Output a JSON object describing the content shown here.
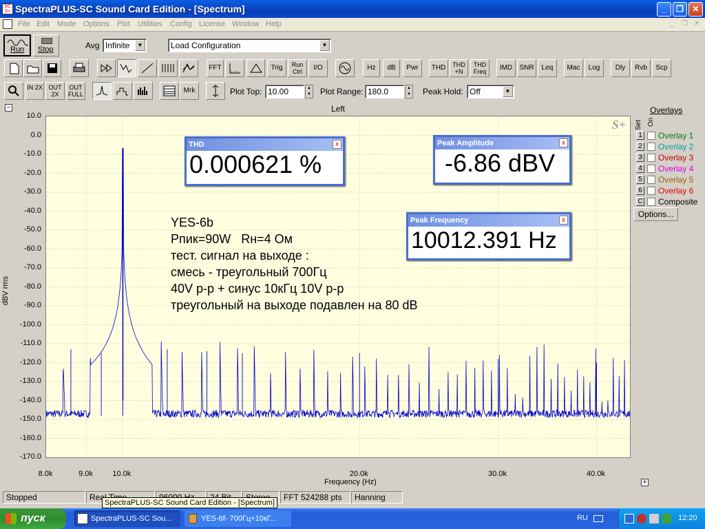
{
  "window": {
    "title": "SpectraPLUS-SC Sound Card Edition - [Spectrum]",
    "min": "_",
    "restore": "❐",
    "close": "✕"
  },
  "menu": [
    "File",
    "Edit",
    "Mode",
    "Options",
    "Plot",
    "Utilities",
    "Config",
    "License",
    "Window",
    "Help"
  ],
  "mdi": {
    "min": "_",
    "restore": "❐",
    "close": "✕"
  },
  "toolbar1": {
    "run": "Run",
    "stop": "Stop",
    "avg_label": "Avg",
    "avg_value": "Infinite",
    "config_value": "Load Configuration"
  },
  "toolbar2": [
    "FFT",
    "Trig",
    "Run Ctrl",
    "I/O",
    "Hz",
    "dB",
    "Pwr",
    "THD",
    "THD +N",
    "THD Freq",
    "IMD",
    "SNR",
    "Leq",
    "Mac",
    "Log",
    "Dly",
    "Rvb",
    "Scp"
  ],
  "toolbar3": {
    "zoom_in": "IN 2X",
    "zoom_out": "OUT 2X",
    "zoom_full": "OUT FULL",
    "mrk": "Mrk",
    "plot_top_label": "Plot Top:",
    "plot_top": "10.00",
    "plot_range_label": "Plot Range:",
    "plot_range": "180.0",
    "peak_hold_label": "Peak Hold:",
    "peak_hold": "Off"
  },
  "plot": {
    "collapse": "−",
    "channel": "Left",
    "ylabel": "dBV rms",
    "xlabel": "Frequency (Hz)",
    "logo": "S+",
    "expand": "+",
    "yticks": [
      "10.0",
      "0.0",
      "-10.0",
      "-20.0",
      "-30.0",
      "-40.0",
      "-50.0",
      "-60.0",
      "-70.0",
      "-80.0",
      "-90.0",
      "-100.0",
      "-110.0",
      "-120.0",
      "-130.0",
      "-140.0",
      "-150.0",
      "-160.0",
      "-170.0"
    ],
    "xticks": [
      "8.0k",
      "9.0k",
      "10.0k",
      "20.0k",
      "30.0k",
      "40.0k"
    ]
  },
  "chart_data": {
    "type": "line",
    "xlabel": "Frequency (Hz)",
    "ylabel": "dBV rms",
    "ylim": [
      -170,
      10
    ],
    "xlim": [
      8000,
      44100
    ],
    "xscale": "log",
    "grid": true,
    "series": [
      {
        "values_x": [
          10012.391
        ],
        "values_y": [
          -6.86
        ]
      }
    ],
    "color": "#0000c8",
    "noise_floor_dbv": -147,
    "peaks": [
      {
        "x": 8600.0,
        "y": -113
      },
      {
        "x": 9400.0,
        "y": -115
      },
      {
        "x": 10012.391,
        "y": -6.86
      },
      {
        "x": 11400.0,
        "y": -113
      },
      {
        "x": 12800.0,
        "y": -114
      },
      {
        "x": 14200.0,
        "y": -115
      },
      {
        "x": 20000.0,
        "y": -115
      },
      {
        "x": 30000.0,
        "y": -118
      },
      {
        "x": 40000.0,
        "y": -120
      }
    ]
  },
  "meters": {
    "thd": {
      "title": "THD",
      "value": "0.000621 %"
    },
    "peak_amp": {
      "title": "Peak Amplitude",
      "value": "-6.86 dBV"
    },
    "peak_freq": {
      "title": "Peak Frequency",
      "value": "10012.391 Hz"
    },
    "close": "x"
  },
  "annotation": [
    "YES-6b",
    "Рпик=90W   Rн=4 Ом",
    "тест. сигнал на выходе :",
    "смесь - треугольный 700Гц",
    "40V p-p + синус 10кГц 10V p-p",
    "треугольный на выходе подавлен на 80 dB"
  ],
  "overlays": {
    "title": "Overlays",
    "set": "Set",
    "on": "On",
    "items": [
      {
        "n": "1",
        "label": "Overlay 1",
        "color": "#008000"
      },
      {
        "n": "2",
        "label": "Overlay 2",
        "color": "#00a0a0"
      },
      {
        "n": "3",
        "label": "Overlay 3",
        "color": "#c00000"
      },
      {
        "n": "4",
        "label": "Overlay 4",
        "color": "#e000e0"
      },
      {
        "n": "5",
        "label": "Overlay 5",
        "color": "#a06000"
      },
      {
        "n": "6",
        "label": "Overlay 6",
        "color": "#e00000"
      },
      {
        "n": "C",
        "label": "Composite",
        "color": "#000000"
      }
    ],
    "options": "Options..."
  },
  "status": {
    "state": "Stopped",
    "realtime": "Real Time",
    "rate": "96000 Hz",
    "bits": "24 Bit",
    "stereo": "Stereo",
    "fft": "FFT 524288 pts",
    "window": "Hanning"
  },
  "tooltip": "SpectraPLUS-SC Sound Card Edition - [Spectrum]",
  "taskbar": {
    "start": "пуск",
    "task1": "SpectraPLUS-SC Sou...",
    "task2": "YES-6f- 700Гц+10кГ...",
    "lang": "RU",
    "time": "12:20"
  }
}
